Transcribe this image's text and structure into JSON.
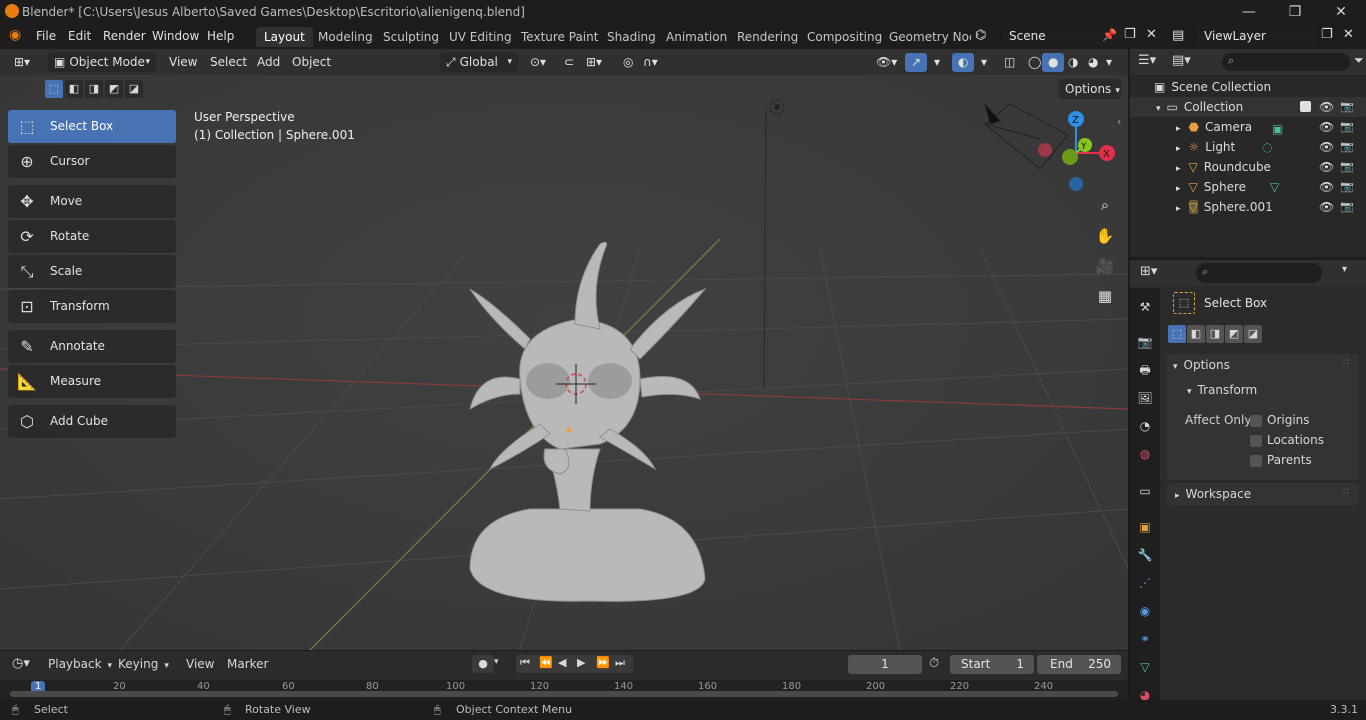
{
  "window": {
    "title": "Blender* [C:\\Users\\Jesus Alberto\\Saved Games\\Desktop\\Escritorio\\alienigenq.blend]",
    "minimize": "—",
    "maximize": "❐",
    "close": "✕"
  },
  "menu": {
    "items": [
      "File",
      "Edit",
      "Render",
      "Window",
      "Help"
    ]
  },
  "workspaces": {
    "tabs": [
      "Layout",
      "Modeling",
      "Sculpting",
      "UV Editing",
      "Texture Paint",
      "Shading",
      "Animation",
      "Rendering",
      "Compositing",
      "Geometry Noc"
    ],
    "active": "Layout"
  },
  "scene": {
    "name": "Scene",
    "view_layer": "ViewLayer"
  },
  "viewport_header": {
    "mode": "Object Mode",
    "menus": [
      "View",
      "Select",
      "Add",
      "Object"
    ],
    "transform_orientation": "Global",
    "options_label": "Options"
  },
  "viewport": {
    "perspective": "User Perspective",
    "collection_info": "(1) Collection | Sphere.001",
    "axis_labels": {
      "x": "X",
      "y": "Y",
      "z": "Z"
    }
  },
  "tools": [
    {
      "label": "Select Box",
      "icon": "select-box-icon",
      "glyph": "⬚",
      "active": true
    },
    {
      "label": "Cursor",
      "icon": "cursor-icon",
      "glyph": "⊕",
      "active": false
    },
    {
      "label": "Move",
      "icon": "move-icon",
      "glyph": "✥",
      "active": false
    },
    {
      "label": "Rotate",
      "icon": "rotate-icon",
      "glyph": "⟳",
      "active": false
    },
    {
      "label": "Scale",
      "icon": "scale-icon",
      "glyph": "⤡",
      "active": false
    },
    {
      "label": "Transform",
      "icon": "transform-icon",
      "glyph": "⊡",
      "active": false
    },
    {
      "label": "Annotate",
      "icon": "annotate-icon",
      "glyph": "✎",
      "active": false
    },
    {
      "label": "Measure",
      "icon": "measure-icon",
      "glyph": "📐",
      "active": false
    },
    {
      "label": "Add Cube",
      "icon": "add-cube-icon",
      "glyph": "⬡",
      "active": false
    }
  ],
  "outliner": {
    "root": "Scene Collection",
    "collection": "Collection",
    "items": [
      "Camera",
      "Light",
      "Roundcube",
      "Sphere",
      "Sphere.001"
    ]
  },
  "properties": {
    "active_tool": "Select Box",
    "options_label": "Options",
    "transform_label": "Transform",
    "affect_only_label": "Affect Only",
    "checkboxes": [
      "Origins",
      "Locations",
      "Parents"
    ],
    "workspace_label": "Workspace"
  },
  "timeline": {
    "menus": [
      "Playback",
      "Keying",
      "View",
      "Marker"
    ],
    "current_frame": "1",
    "start_label": "Start",
    "start": "1",
    "end_label": "End",
    "end": "250",
    "ruler": [
      "1",
      "20",
      "40",
      "60",
      "80",
      "100",
      "120",
      "140",
      "160",
      "180",
      "200",
      "220",
      "240"
    ]
  },
  "status": {
    "select": "Select",
    "rotate_view": "Rotate View",
    "context_menu": "Object Context Menu",
    "version": "3.3.1"
  },
  "colors": {
    "accent": "#4772b3",
    "x_axis": "#e5304b",
    "y_axis": "#8ac721",
    "z_axis": "#2e8fe6",
    "viewport_bg": "#3d3d3d"
  }
}
